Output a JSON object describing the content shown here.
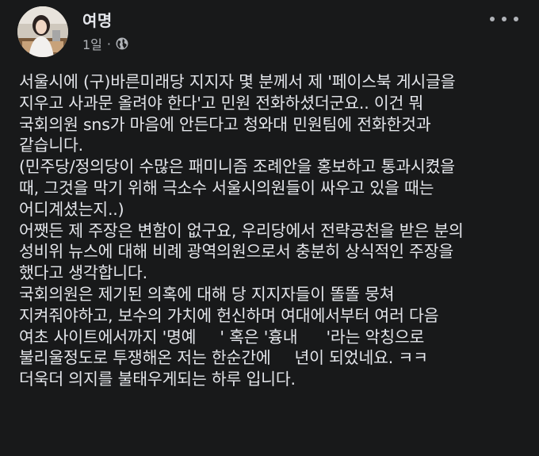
{
  "post": {
    "author": "여명",
    "time": "1일",
    "separator": "·",
    "privacy_icon": "globe-icon",
    "more_icon": "more-horizontal-icon",
    "lines": [
      "서울시에 (구)바른미래당 지지자 몇 분께서 제 '페이스북 게시글을",
      "지우고 사과문 올려야 한다'고 민원 전화하셨더군요.. 이건 뭐",
      "국회의원 sns가 마음에 안든다고 청와대 민원팀에 전화한것과",
      "같습니다.",
      "(민주당/정의당이 수많은 패미니즘 조례안을 홍보하고 통과시켰을",
      "때, 그것을 막기 위해 극소수 서울시의원들이 싸우고 있을 때는",
      "어디계셨는지..)",
      "어쨋든 제 주장은 변함이 없구요, 우리당에서 전략공천을 받은 분의",
      "성비위 뉴스에 대해 비례 광역의원으로서 충분히 상식적인 주장을",
      "했다고 생각합니다.",
      "국회의원은 제기된 의혹에 대해 당 지지자들이 똘똘 뭉쳐",
      "지켜줘야하고, 보수의 가치에 헌신하며 여대에서부터 여러 다음",
      "여초 사이트에서까지 '명예",
      "' 혹은 '흉내",
      "'라는 악칭으로",
      "불리울정도로 투쟁해온 저는 한순간에",
      "년이 되었네요. ㅋㅋ",
      "더욱더 의지를 불태우게되는 하루 입니다."
    ]
  }
}
